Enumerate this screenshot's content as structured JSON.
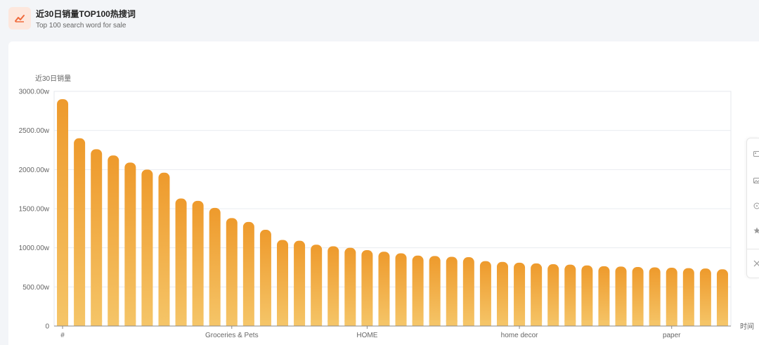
{
  "header": {
    "icon": "trend-chart-icon",
    "title": "近30日销量TOP100热搜词",
    "subtitle": "Top 100 search word for sale"
  },
  "side_toolbar": {
    "icons": [
      "image-icon",
      "image-icon",
      "chat-icon",
      "star-icon",
      "close-icon"
    ]
  },
  "colors": {
    "bar_top": "#ee9a2c",
    "bar_bottom": "#f5c568",
    "icon_accent": "#f06a3c",
    "grid": "#e9ecf0",
    "axis_text": "#666666"
  },
  "chart_data": {
    "type": "bar",
    "ylabel": "近30日销量",
    "xlabel": "时间",
    "ylim": [
      0,
      3000
    ],
    "yticks": [
      "0",
      "500.00w",
      "1000.00w",
      "1500.00w",
      "2000.00w",
      "2500.00w",
      "3000.00w"
    ],
    "x_tick_labels": [
      {
        "index": 0,
        "label": "#"
      },
      {
        "index": 10,
        "label": "Groceries & Pets"
      },
      {
        "index": 18,
        "label": "HOME"
      },
      {
        "index": 27,
        "label": "home decor"
      },
      {
        "index": 36,
        "label": "paper"
      }
    ],
    "unit": "w",
    "grid": true,
    "values": [
      2900,
      2400,
      2260,
      2180,
      2090,
      2000,
      1960,
      1630,
      1600,
      1510,
      1380,
      1330,
      1230,
      1100,
      1090,
      1040,
      1020,
      1000,
      970,
      950,
      930,
      900,
      895,
      885,
      880,
      830,
      820,
      810,
      800,
      790,
      785,
      775,
      765,
      760,
      755,
      750,
      745,
      740,
      735,
      725
    ]
  }
}
